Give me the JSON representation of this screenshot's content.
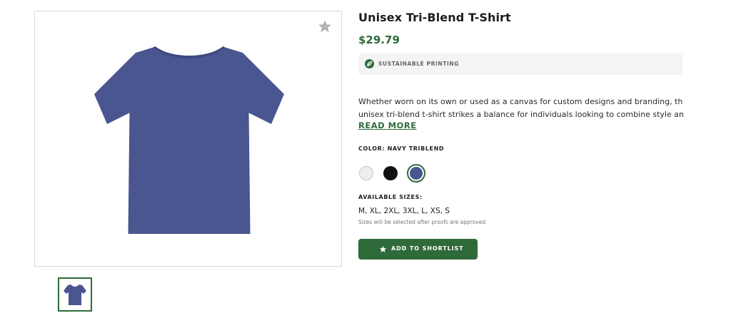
{
  "product": {
    "title": "Unisex Tri-Blend T-Shirt",
    "price": "$29.79",
    "badge": "SUSTAINABLE PRINTING",
    "description_lines": [
      "Whether worn on its own or used as a canvas for custom designs and branding, the",
      "unisex tri-blend t-shirt strikes a balance for individuals looking to combine style an…"
    ],
    "read_more": "READ MORE",
    "color_label": "COLOR: NAVY TRIBLEND",
    "colors": [
      {
        "name": "white",
        "hex": "#eeeeee",
        "selected": false
      },
      {
        "name": "black",
        "hex": "#111111",
        "selected": false
      },
      {
        "name": "navy triblend",
        "hex": "#4a5690",
        "selected": true
      }
    ],
    "sizes_label": "AVAILABLE SIZES:",
    "sizes": "M, XL, 2XL, 3XL, L, XS, S",
    "sizes_note": "Sizes will be selected after proofs are approved",
    "shortlist_button": "ADD TO SHORTLIST"
  },
  "icons": {
    "favorite": "star-icon",
    "badge": "leaf-icon",
    "button": "star-icon"
  },
  "colors": {
    "accent": "#2f6a3a",
    "shirt": "#4a5690"
  }
}
